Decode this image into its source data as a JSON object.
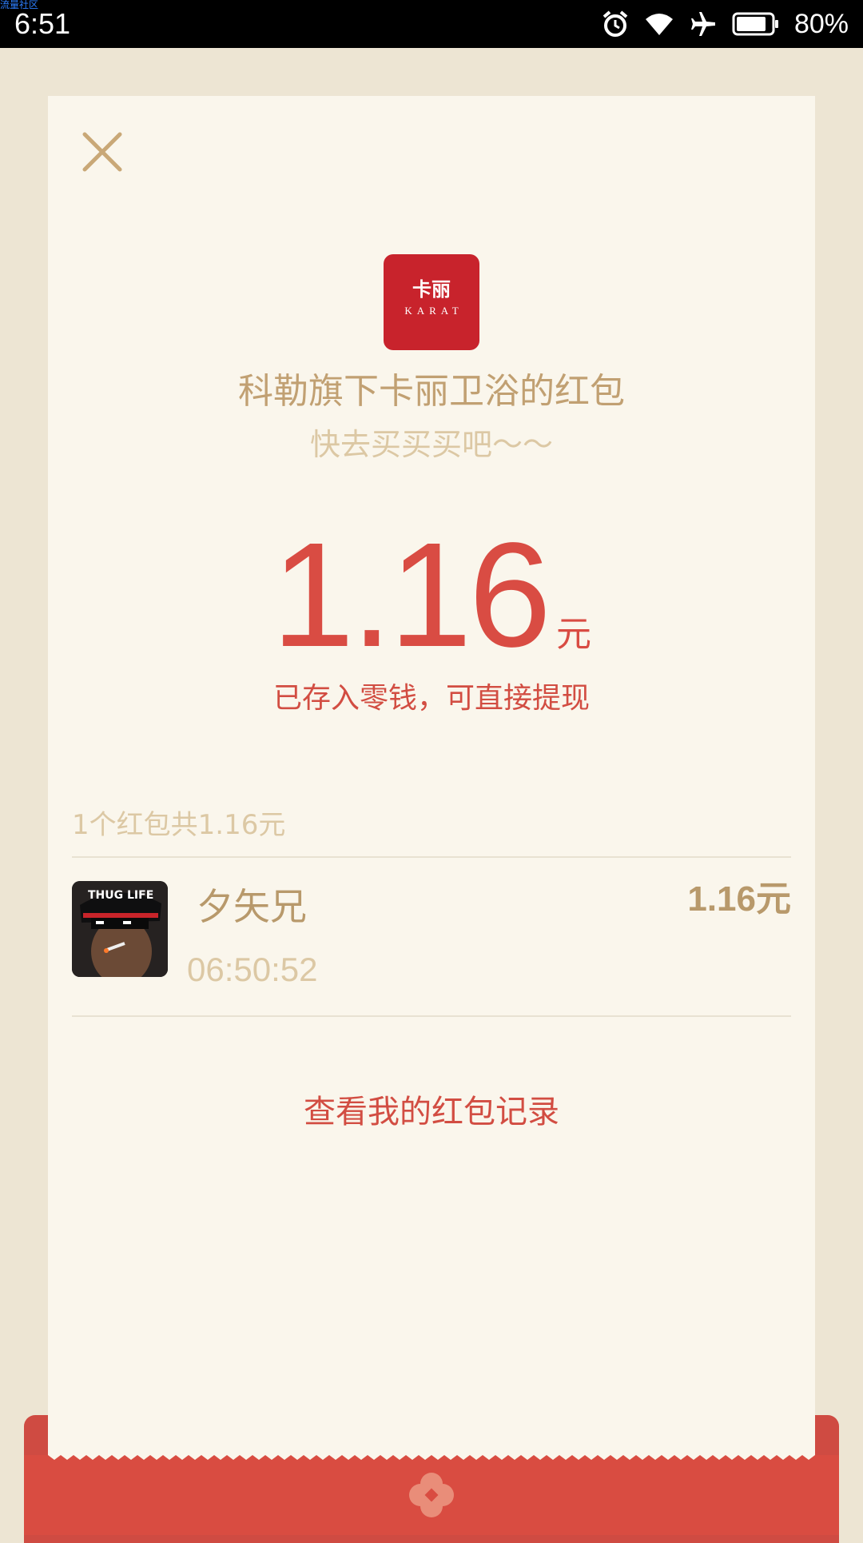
{
  "watermark": "流量社区",
  "status_bar": {
    "time": "6:51",
    "battery": "80%",
    "icons": [
      "alarm-icon",
      "wifi-icon",
      "airplane-icon",
      "battery-icon"
    ]
  },
  "packet": {
    "logo_cn": "卡丽",
    "logo_en": "KARAT",
    "sender_title": "科勒旗下卡丽卫浴的红包",
    "wish": "快去买买买吧～～",
    "amount": "1.16",
    "amount_unit": "元",
    "stored_note": "已存入零钱，可直接提现",
    "summary": "1个红包共1.16元"
  },
  "records": [
    {
      "name": "夕矢兄",
      "time": "06:50:52",
      "amount": "1.16元",
      "avatar_text": "THUG LIFE"
    }
  ],
  "actions": {
    "view_records": "查看我的红包记录"
  },
  "colors": {
    "background": "#ede5d3",
    "card": "#faf6ec",
    "accent_red": "#d94c43",
    "gold_text": "#c1a072",
    "envelope_red": "#d94c41",
    "logo_red": "#c8232c"
  }
}
